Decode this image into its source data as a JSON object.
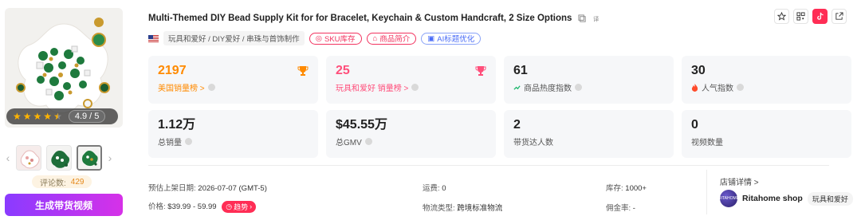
{
  "product": {
    "title": "Multi-Themed DIY Bead Supply Kit for for Bracelet, Keychain & Custom Handcraft, 2 Size Options",
    "rating": "4.9 / 5",
    "stars": 4.9,
    "category": "玩具和爱好 / DIY爱好 / 串珠与首饰制作",
    "review_label": "评论数:",
    "review_count": "429",
    "generate_button": "生成带货视频"
  },
  "pills": {
    "sku": "SKU库存",
    "intro": "商品简介",
    "ai": "AI标题优化"
  },
  "icons": {
    "copy": "copy-icon",
    "translate": "translate-icon",
    "star": "star-outline-icon",
    "qrcode": "qrcode-icon",
    "tiktok": "tiktok-icon",
    "external": "external-link-icon"
  },
  "stats": {
    "us_rank": {
      "value": "2197",
      "label": "美国销量榜 >"
    },
    "cat_rank": {
      "value": "25",
      "label": "玩具和爱好 销量榜 >"
    },
    "heat": {
      "value": "61",
      "label": "商品热度指数"
    },
    "popularity": {
      "value": "30",
      "label": "人气指数"
    },
    "sales": {
      "value": "1.12万",
      "label": "总销量"
    },
    "gmv": {
      "value": "$45.55万",
      "label": "总GMV"
    },
    "influencers": {
      "value": "2",
      "label": "带货达人数"
    },
    "videos": {
      "value": "0",
      "label": "视频数量"
    }
  },
  "meta": {
    "launch_key": "预估上架日期:",
    "launch_val": "2026-07-07 (GMT-5)",
    "price_key": "价格:",
    "price_val": "$39.99 - 59.99",
    "trend_label": "趋势",
    "shipping_key": "运费:",
    "shipping_val": "0",
    "logistics_key": "物流类型:",
    "logistics_val": "跨境标准物流",
    "stock_key": "库存:",
    "stock_val": "1000+",
    "commission_key": "佣金率:",
    "commission_val": "-"
  },
  "shop": {
    "details_link": "店铺详情 >",
    "name": "Ritahome shop",
    "category": "玩具和爱好",
    "logo_text": "RITAHOME"
  },
  "colors": {
    "accent_orange": "#ff8a00",
    "accent_pink": "#ff4f7b",
    "button_gradient_start": "#8a3bff",
    "button_gradient_end": "#d631e8"
  }
}
